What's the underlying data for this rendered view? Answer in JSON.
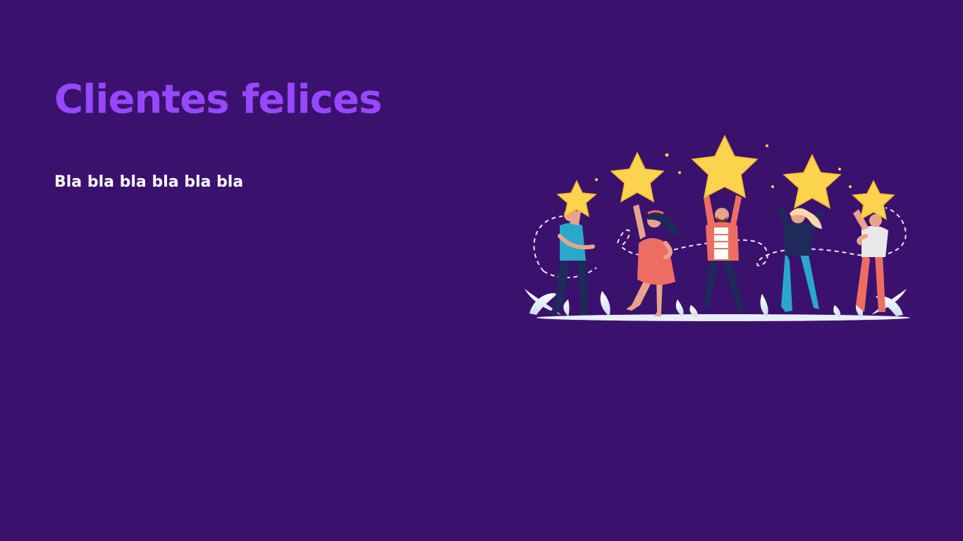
{
  "heading": {
    "title": "Clientes felices",
    "subtitle": "Bla bla bla bla bla bla"
  },
  "illustration": {
    "icon": "happy-customers-with-stars-illustration",
    "stars": 5,
    "people": 5
  },
  "colors": {
    "background": "#3b116e",
    "title": "#9747ff",
    "subtitle": "#ffffff",
    "star": "#fcd34d"
  }
}
